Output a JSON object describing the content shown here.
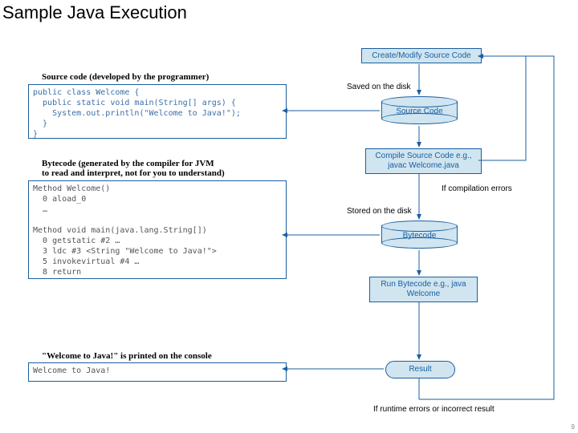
{
  "title": "Sample Java Execution",
  "captions": {
    "source": "Source code (developed by the programmer)",
    "bytecode": "Bytecode (generated by the compiler for JVM\nto read and interpret, not for you to understand)",
    "console": "\"Welcome to Java!\" is printed on the console"
  },
  "code": {
    "source": "public class Welcome {\n  public static void main(String[] args) {\n    System.out.println(\"Welcome to Java!\");\n  }\n}",
    "bytecode": "Method Welcome()\n  0 aload_0\n  …\n\nMethod void main(java.lang.String[])\n  0 getstatic #2 …\n  3 ldc #3 <String \"Welcome to Java!\">\n  5 invokevirtual #4 …\n  8 return",
    "output": "Welcome to Java!"
  },
  "flow": {
    "create": "Create/Modify Source Code",
    "sourcecyl": "Source Code",
    "compile": "Compile Source Code\ne.g., javac Welcome.java",
    "bytecyl": "Bytecode",
    "run": "Run Bytecode\ne.g., java Welcome",
    "result": "Result"
  },
  "labels": {
    "saved": "Saved on the disk",
    "stored": "Stored on the disk",
    "comp_err": "If compilation errors",
    "run_err": "If runtime errors or incorrect result"
  },
  "page": "9"
}
